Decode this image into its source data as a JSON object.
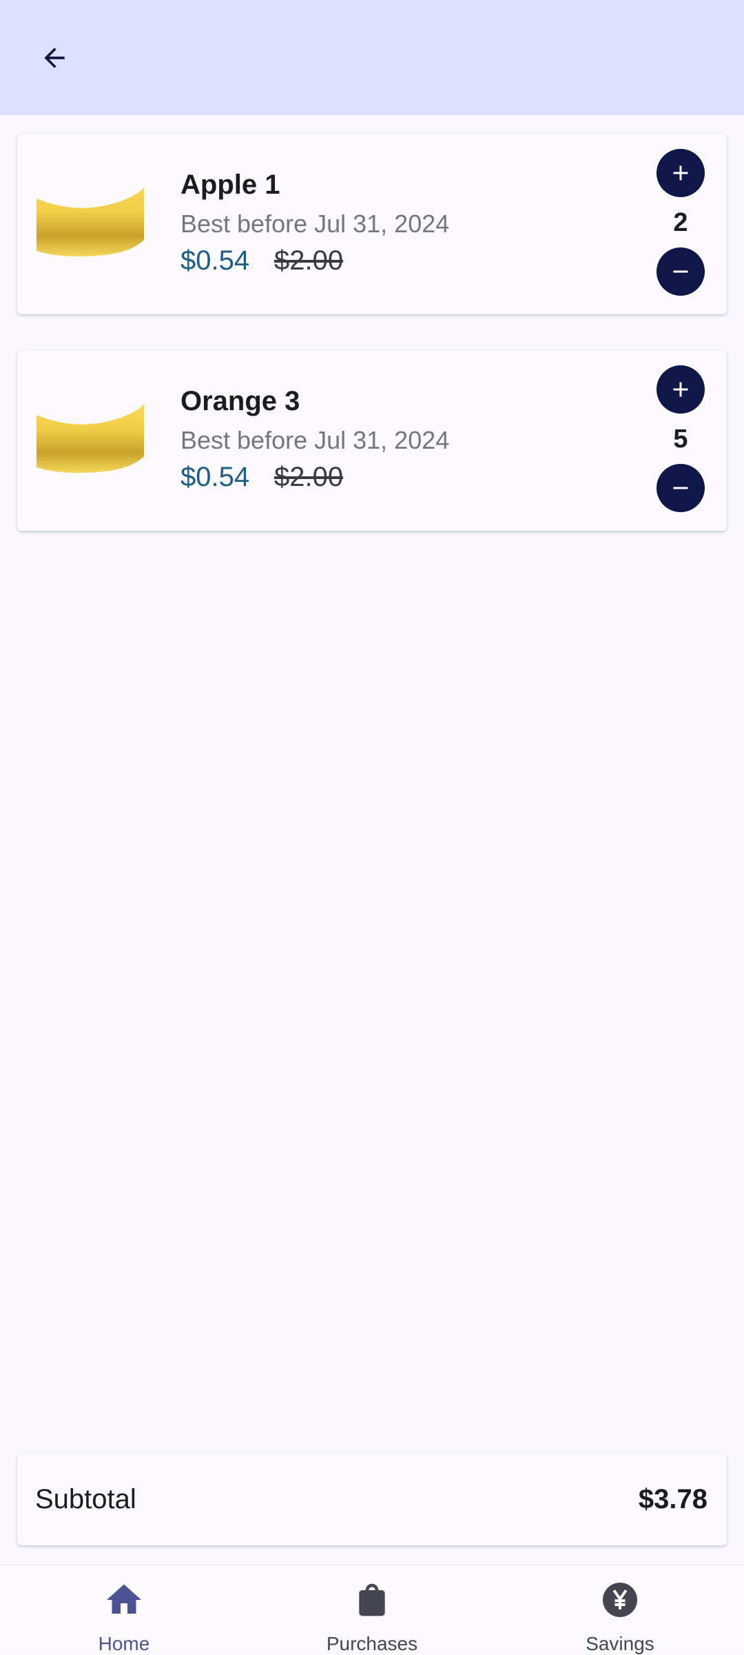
{
  "header": {
    "back_icon": "arrow-back-icon"
  },
  "items": [
    {
      "name": "Apple 1",
      "best_before": "Best before Jul 31, 2024",
      "price": "$0.54",
      "old_price": "$2.00",
      "quantity": "2"
    },
    {
      "name": "Orange 3",
      "best_before": "Best before Jul 31, 2024",
      "price": "$0.54",
      "old_price": "$2.00",
      "quantity": "5"
    }
  ],
  "subtotal": {
    "label": "Subtotal",
    "value": "$3.78"
  },
  "nav": [
    {
      "label": "Home",
      "icon": "home-icon",
      "active": true
    },
    {
      "label": "Purchases",
      "icon": "shopping-bag-icon",
      "active": false
    },
    {
      "label": "Savings",
      "icon": "yen-coin-icon",
      "active": false
    }
  ],
  "colors": {
    "topbar": "#dde1ff",
    "background": "#faf7ff",
    "button": "#0f1748",
    "price": "#1d5e87",
    "active_nav": "#4b5394"
  }
}
